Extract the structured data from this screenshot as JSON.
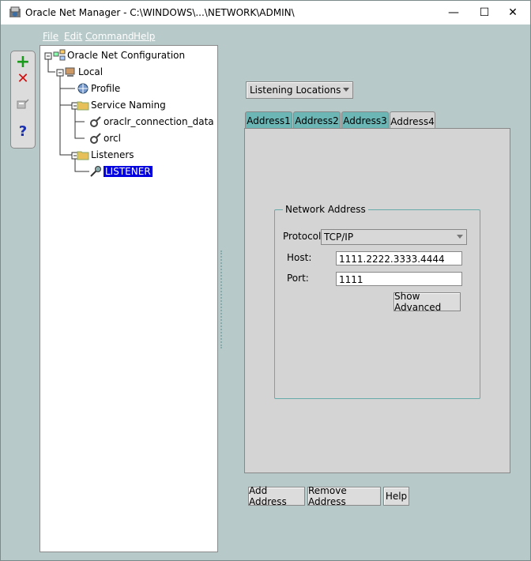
{
  "window": {
    "title": "Oracle Net Manager - C:\\WINDOWS\\...\\NETWORK\\ADMIN\\",
    "controls": {
      "minimize": "—",
      "maximize": "☐",
      "close": "✕"
    }
  },
  "menu": {
    "file": "File",
    "edit": "Edit",
    "command": "Command",
    "help": "Help"
  },
  "toolbar": {
    "create": "+",
    "delete": "✕",
    "test": "",
    "help": "?"
  },
  "tree": {
    "root": "Oracle Net Configuration",
    "local": "Local",
    "profile": "Profile",
    "service_naming": "Service Naming",
    "service1": "oraclr_connection_data",
    "service2": "orcl",
    "listeners": "Listeners",
    "listener": "LISTENER"
  },
  "view_selector": "Listening Locations",
  "tabs": [
    "Address1",
    "Address2",
    "Address3",
    "Address4"
  ],
  "address": {
    "group_title": "Network Address",
    "protocol_label": "Protocol:",
    "protocol_value": "TCP/IP",
    "host_label": "Host:",
    "host_value": "1111.2222.3333.4444",
    "port_label": "Port:",
    "port_value": "1111",
    "show_advanced": "Show Advanced"
  },
  "buttons": {
    "add_address": "Add Address",
    "remove_address": "Remove Address",
    "help": "Help"
  },
  "colors": {
    "tab_inactive": "#6cb6b6",
    "selection": "#0000e0"
  }
}
